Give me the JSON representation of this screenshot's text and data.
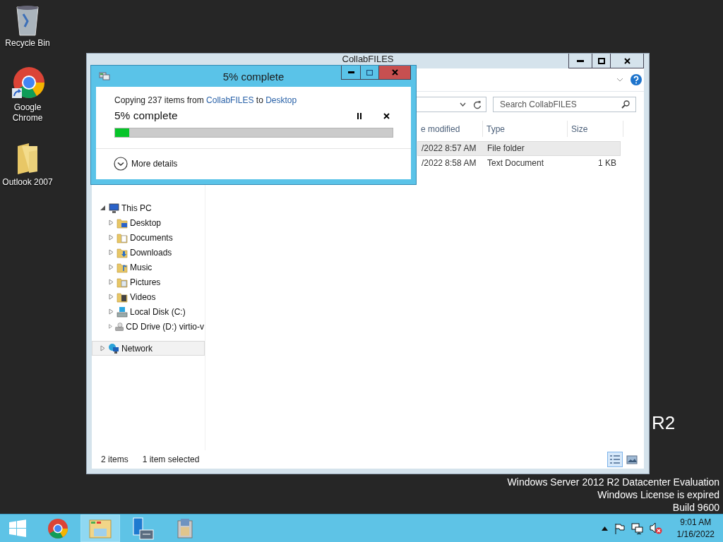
{
  "desktop_icons": [
    {
      "label": "Recycle Bin",
      "kind": "recycle"
    },
    {
      "label": "Google Chrome",
      "kind": "chrome"
    },
    {
      "label": "Outlook 2007",
      "kind": "folder"
    }
  ],
  "watermark": {
    "edition_suffix": "R2",
    "lines": [
      "Windows Server 2012 R2 Datacenter Evaluation",
      "Windows License is expired",
      "Build 9600"
    ]
  },
  "explorer": {
    "title": "CollabFILES",
    "search": {
      "placeholder": "Search CollabFILES"
    },
    "columns": [
      "e modified",
      "Type",
      "Size"
    ],
    "rows": [
      {
        "date": "/2022 8:57 AM",
        "type": "File folder",
        "selected": true
      },
      {
        "date": "/2022 8:58 AM",
        "type": "Text Document",
        "size": "1 KB",
        "selected": false
      }
    ],
    "nav": [
      {
        "label": "This PC",
        "kind": "pc",
        "expanded": true,
        "selected": false,
        "children": [
          {
            "label": "Desktop",
            "kind": "desktop",
            "expanded": false,
            "selected": false
          },
          {
            "label": "Documents",
            "kind": "documents",
            "expanded": false,
            "selected": false
          },
          {
            "label": "Downloads",
            "kind": "downloads",
            "expanded": false,
            "selected": false
          },
          {
            "label": "Music",
            "kind": "music",
            "expanded": false,
            "selected": false
          },
          {
            "label": "Pictures",
            "kind": "pictures",
            "expanded": false,
            "selected": false
          },
          {
            "label": "Videos",
            "kind": "videos",
            "expanded": false,
            "selected": false
          },
          {
            "label": "Local Disk (C:)",
            "kind": "disk",
            "expanded": false,
            "selected": false
          },
          {
            "label": "CD Drive (D:) virtio-v",
            "kind": "cd",
            "expanded": false,
            "selected": false
          }
        ]
      },
      {
        "label": "Network",
        "kind": "network",
        "expanded": false,
        "selected": true
      }
    ],
    "status": {
      "count": "2 items",
      "selection": "1 item selected"
    },
    "views": [
      {
        "kind": "details",
        "selected": true
      },
      {
        "kind": "tiles",
        "selected": false
      }
    ]
  },
  "copy_dialog": {
    "title": "5% complete",
    "prefix": "Copying 237 items from",
    "source": "CollabFILES",
    "joiner": "to",
    "destination": "Desktop",
    "status": "5% complete",
    "level": 0.05,
    "more": "More details"
  },
  "taskbar": {
    "apps": [
      {
        "kind": "start",
        "selected": false
      },
      {
        "kind": "chrome",
        "selected": false
      },
      {
        "kind": "explorer",
        "selected": true
      },
      {
        "kind": "server",
        "selected": false
      },
      {
        "kind": "tools",
        "selected": false
      }
    ],
    "tray": [
      {
        "kind": "arrow"
      },
      {
        "kind": "flag"
      },
      {
        "kind": "network"
      },
      {
        "kind": "volume_muted"
      }
    ],
    "clock": {
      "time": "9:01 AM",
      "date": "1/16/2022"
    }
  }
}
